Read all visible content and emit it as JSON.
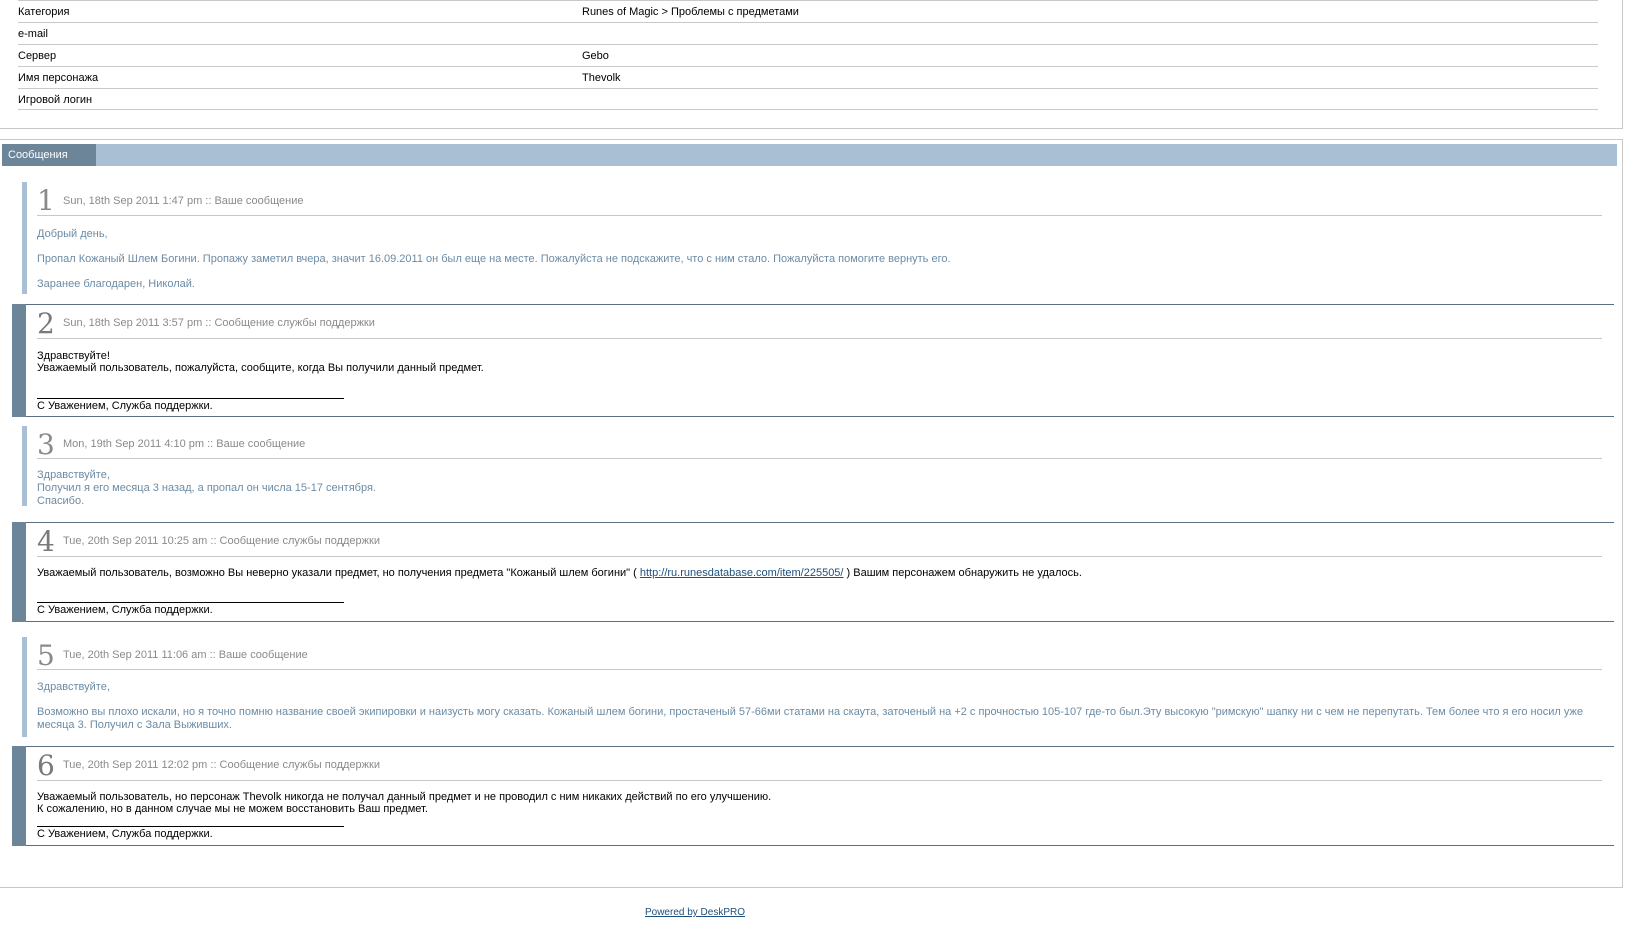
{
  "info": {
    "rows": [
      {
        "label": "Категория",
        "value": "Runes of Magic > Проблемы с предметами"
      },
      {
        "label": "e-mail",
        "value": ""
      },
      {
        "label": "Сервер",
        "value": "Gebo"
      },
      {
        "label": "Имя персонажа",
        "value": "Thevolk"
      },
      {
        "label": "Игровой логин",
        "value": ""
      }
    ]
  },
  "messages_panel": {
    "tab_label": "Сообщения"
  },
  "messages": [
    {
      "num": "1",
      "meta": "Sun, 18th Sep 2011 1:47 pm :: Ваше сообщение",
      "author": "user",
      "lines": [
        "Добрый день,",
        "Пропал Кожаный Шлем Богини. Пропажу заметил вчера, значит 16.09.2011 он был еще на месте. Пожалуйста не подскажите, что с ним стало. Пожалуйста помогите вернуть его.",
        "Заранее благодарен, Николай."
      ]
    },
    {
      "num": "2",
      "meta": "Sun, 18th Sep 2011 3:57 pm :: Сообщение службы поддержки",
      "author": "staff",
      "lines": [
        "Здравствуйте!",
        "Уважаемый пользователь, пожалуйста, сообщите, когда Вы получили данный предмет."
      ],
      "signature": "С Уважением, Служба поддержки."
    },
    {
      "num": "3",
      "meta": "Mon, 19th Sep 2011 4:10 pm :: Ваше сообщение",
      "author": "user",
      "lines": [
        "Здравствуйте,",
        "Получил я его месяца 3 назад, а пропал он числа 15-17 сентября.",
        "Спасибо."
      ]
    },
    {
      "num": "4",
      "meta": "Tue, 20th Sep 2011 10:25 am :: Сообщение службы поддержки",
      "author": "staff",
      "line_before_link": "Уважаемый пользователь, возможно Вы неверно указали предмет, но получения предмета \"Кожаный шлем богини\" ( ",
      "link": "http://ru.runesdatabase.com/item/225505/",
      "line_after_link": " ) Вашим персонажем обнаружить не удалось.",
      "signature": "С Уважением, Служба поддержки."
    },
    {
      "num": "5",
      "meta": "Tue, 20th Sep 2011 11:06 am :: Ваше сообщение",
      "author": "user",
      "lines": [
        "Здравствуйте,",
        "Возможно вы плохо искали, но я точно помню название своей экипировки и наизусть могу сказать. Кожаный шлем богини, простаченый 57-66ми статами на скаута, заточеный на +2 с прочностью 105-107 где-то был.Эту высокую \"римскую\" шапку ни с чем не перепутать. Тем более что я его носил уже месяца 3. Получил с Зала Выживших."
      ]
    },
    {
      "num": "6",
      "meta": "Tue, 20th Sep 2011 12:02 pm :: Сообщение службы поддержки",
      "author": "staff",
      "lines": [
        "Уважаемый пользователь, но персонаж Thevolk никогда не получал данный предмет и не проводил с ним никаких действий по его улучшению.",
        "К сожалению, но в данном случае мы не можем восстановить Ваш предмет."
      ],
      "signature": "С Уважением, Служба поддержки."
    }
  ],
  "footer": {
    "link": "Powered by DeskPRO"
  },
  "colors": {
    "accent_dark": "#6c8599",
    "accent_light": "#a9bfd4",
    "user_text": "#6c8ba4",
    "link": "#1f4f7a"
  }
}
